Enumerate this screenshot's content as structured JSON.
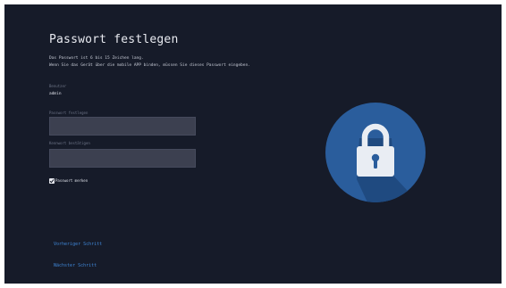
{
  "page": {
    "title": "Passwort festlegen",
    "description_line1": "Das Passwort ist 6 bis 15 Zeichen lang.",
    "description_line2": "Wenn Sie das Gerät über die mobile APP binden, müssen Sie dieses Passwort eingeben."
  },
  "form": {
    "user_label": "Benutzer",
    "user_value": "admin",
    "password_label": "Passwort festlegen",
    "password_value": "",
    "confirm_label": "Kennwort bestätigen",
    "confirm_value": "",
    "remember_label": "Passwort merken",
    "remember_checked": true
  },
  "navigation": {
    "previous_label": "Vorheriger Schritt",
    "next_label": "Nächster Schritt"
  },
  "icons": {
    "lock": "lock-icon",
    "checkbox": "checkmark-icon"
  },
  "colors": {
    "background": "#161b29",
    "accent": "#3f86d6",
    "lock_circle": "#2a5d9c",
    "field": "#3c4050"
  }
}
